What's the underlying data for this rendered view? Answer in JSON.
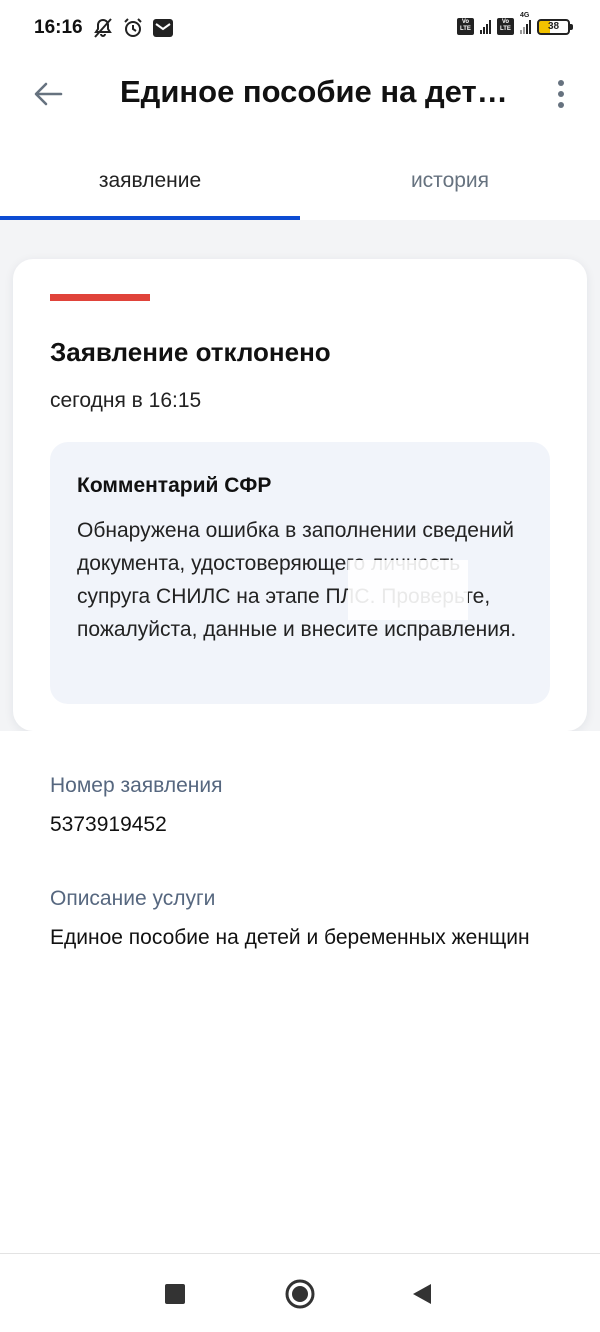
{
  "status_bar": {
    "time": "16:16",
    "battery": "38"
  },
  "appbar": {
    "title": "Единое пособие на детей и беременных женщин"
  },
  "tabs": [
    {
      "label": "заявление",
      "active": true
    },
    {
      "label": "история",
      "active": false
    }
  ],
  "status_card": {
    "stripe_color": "#e0433a",
    "title": "Заявление отклонено",
    "date": "сегодня в 16:15",
    "comment": {
      "heading": "Комментарий СФР",
      "text": "Обнаружена ошибка в заполнении сведений документа, удостоверяющего личность супруга СНИЛС на этапе ПЛС. Проверьте, пожалуйста, данные и внесите исправления."
    }
  },
  "application_number": {
    "label": "Номер заявления",
    "value": "5373919452"
  },
  "service_description": {
    "label": "Описание услуги",
    "value": "Единое пособие на детей и беременных женщин"
  },
  "colors": {
    "accent": "#0d4cd3",
    "label_gray": "#56677f",
    "rejected_red": "#e0433a"
  },
  "icons": [
    "muted-bell-icon",
    "alarm-icon",
    "mail-icon",
    "volte-icon",
    "signal-icon",
    "4g-icon",
    "battery-icon",
    "back-arrow-icon",
    "more-vert-icon",
    "nav-square-icon",
    "nav-circle-icon",
    "nav-back-triangle-icon"
  ]
}
